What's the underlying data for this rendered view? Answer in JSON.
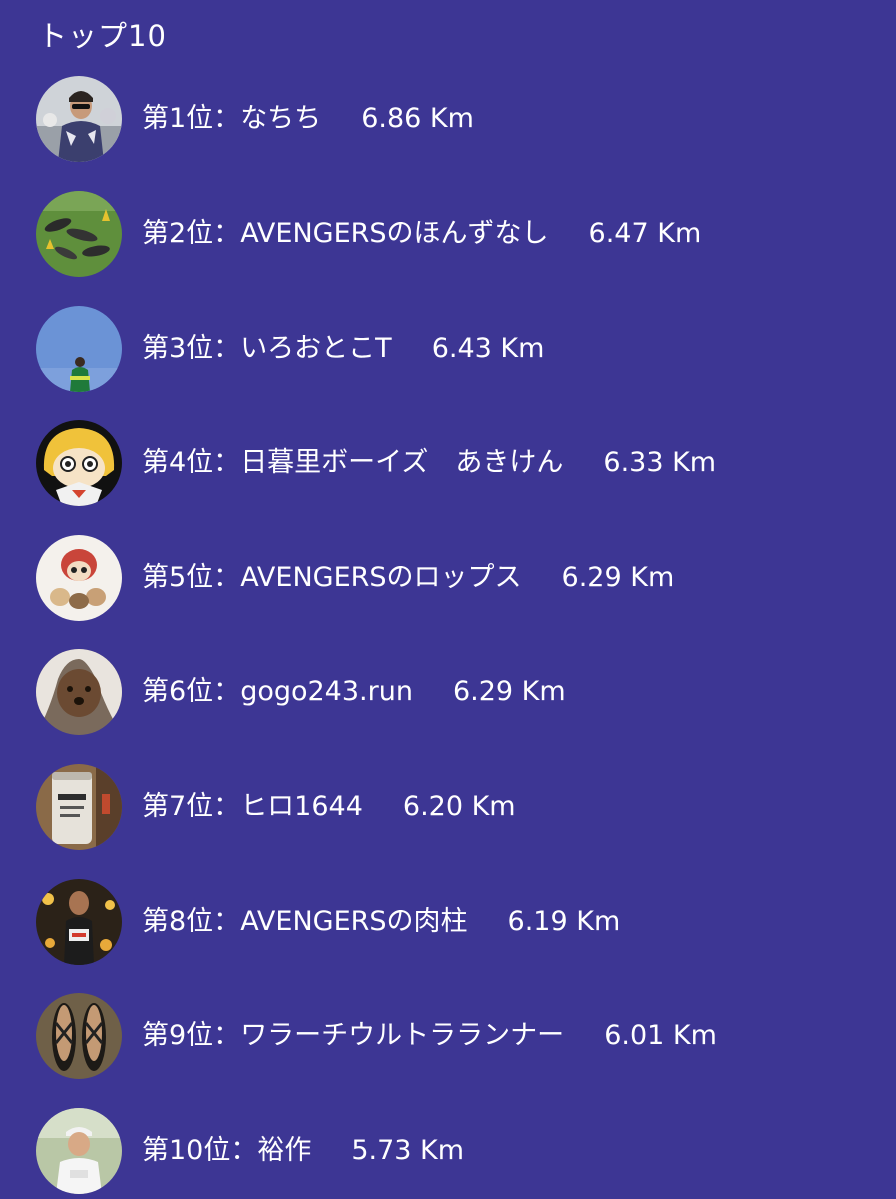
{
  "header": {
    "title": "トップ10"
  },
  "ranking": [
    {
      "rank_label": "第1位：",
      "name": "なちち",
      "distance": "6.86 Km",
      "avatar": "avatar-man-sunglasses"
    },
    {
      "rank_label": "第2位：",
      "name": "AVENGERSのほんずなし",
      "distance": "6.47 Km",
      "avatar": "avatar-people-on-grass"
    },
    {
      "rank_label": "第3位：",
      "name": "いろおとこT",
      "distance": "6.43 Km",
      "avatar": "avatar-runner-sky"
    },
    {
      "rank_label": "第4位：",
      "name": "日暮里ボーイズ　あきけん",
      "distance": "6.33 Km",
      "avatar": "avatar-anime-girl"
    },
    {
      "rank_label": "第5位：",
      "name": "AVENGERSのロップス",
      "distance": "6.29 Km",
      "avatar": "avatar-figurines"
    },
    {
      "rank_label": "第6位：",
      "name": "gogo243.run",
      "distance": "6.29 Km",
      "avatar": "avatar-poodle"
    },
    {
      "rank_label": "第7位：",
      "name": "ヒロ1644",
      "distance": "6.20 Km",
      "avatar": "avatar-beer-can"
    },
    {
      "rank_label": "第8位：",
      "name": "AVENGERSの肉柱",
      "distance": "6.19 Km",
      "avatar": "avatar-marathon-runner"
    },
    {
      "rank_label": "第9位：",
      "name": "ワラーチウルトラランナー",
      "distance": "6.01 Km",
      "avatar": "avatar-sandals"
    },
    {
      "rank_label": "第10位：",
      "name": "裕作",
      "distance": "5.73 Km",
      "avatar": "avatar-man-cap"
    }
  ]
}
